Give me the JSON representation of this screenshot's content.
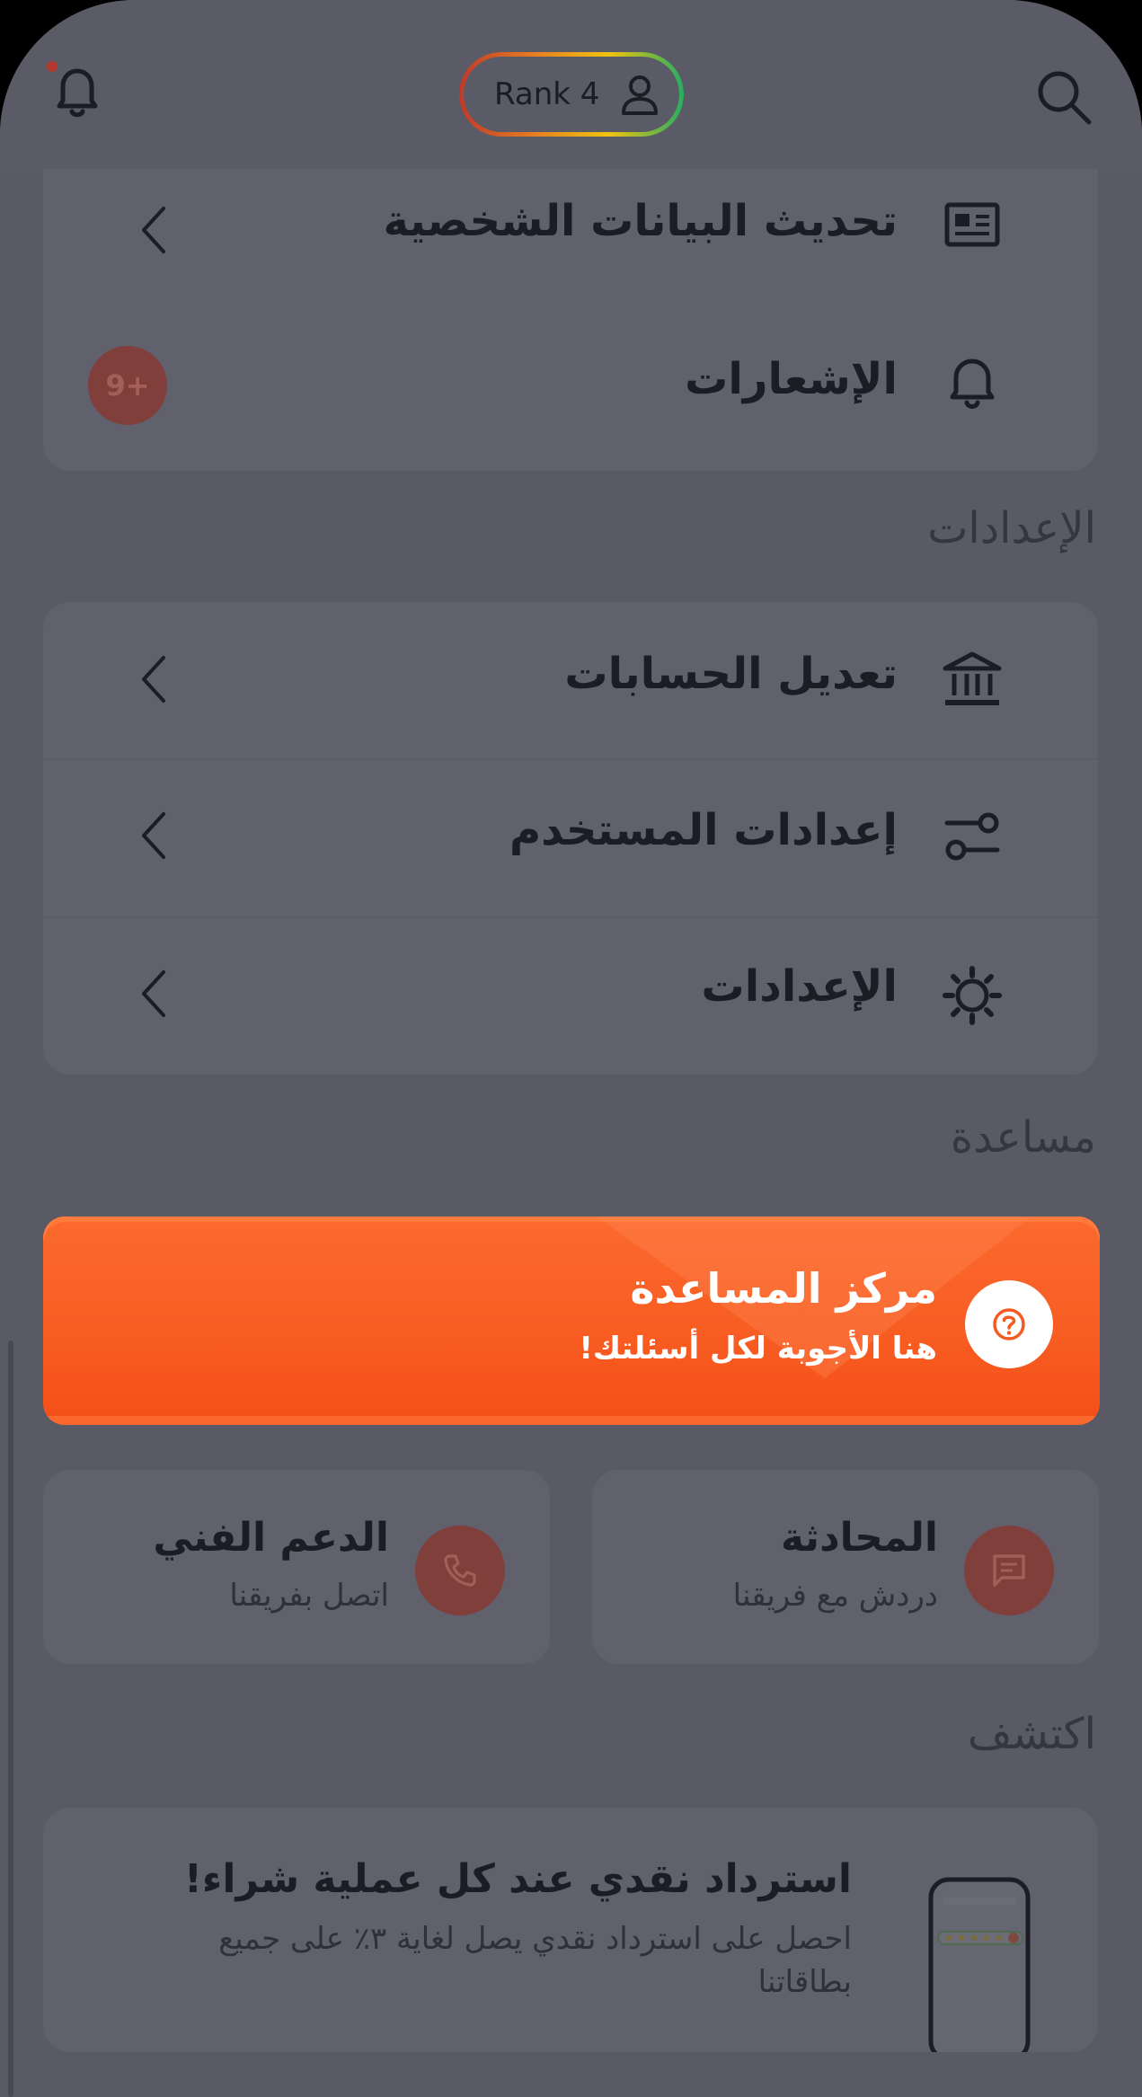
{
  "header": {
    "rank_label": "Rank 4",
    "icons": {
      "left": "bell-icon",
      "center": "user-icon",
      "right": "search-icon"
    },
    "notification_dot_color": "#c0392b"
  },
  "account": {
    "items": [
      {
        "label": "تحديث البيانات الشخصية",
        "icon": "id-card-icon"
      },
      {
        "label": "الإشعارات",
        "icon": "bell-icon",
        "badge": "9+"
      }
    ]
  },
  "settings": {
    "section_title": "الإعدادات",
    "items": [
      {
        "label": "تعديل الحسابات",
        "icon": "bank-icon"
      },
      {
        "label": "إعدادات المستخدم",
        "icon": "sliders-icon"
      },
      {
        "label": "الإعدادات",
        "icon": "gear-icon"
      }
    ]
  },
  "help": {
    "section_title": "مساعدة",
    "banner": {
      "title": "مركز المساعدة",
      "subtitle": "هنا الأجوبة لكل أسئلتك!",
      "icon": "question-icon",
      "color": "#f85d22"
    },
    "chat": {
      "title": "المحادثة",
      "subtitle": "دردش مع فريقنا",
      "icon": "chat-icon"
    },
    "support": {
      "title": "الدعم الفني",
      "subtitle": "اتصل بفريقنا",
      "icon": "phone-icon"
    }
  },
  "discover": {
    "section_title": "اكتشف",
    "promo": {
      "title": "استرداد نقدي عند كل عملية شراء!",
      "subtitle": "احصل على استرداد نقدي يصل لغاية ٣٪ على جميع بطاقاتنا",
      "icon": "phone-cashback-illustration"
    }
  }
}
